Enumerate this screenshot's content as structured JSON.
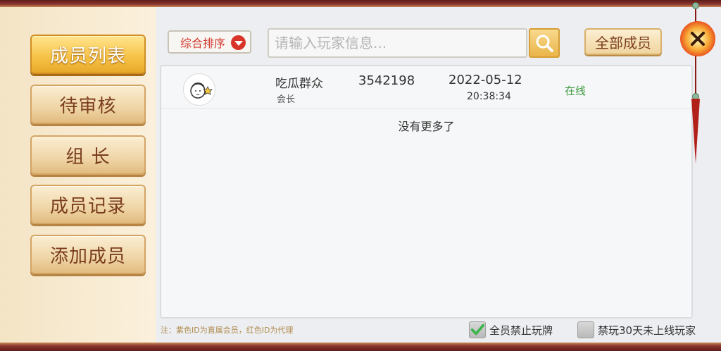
{
  "sidebar": {
    "items": [
      {
        "label": "成员列表",
        "active": true
      },
      {
        "label": "待审核",
        "active": false
      },
      {
        "label": "组 长",
        "active": false
      },
      {
        "label": "成员记录",
        "active": false
      },
      {
        "label": "添加成员",
        "active": false
      }
    ]
  },
  "toolbar": {
    "sort_label": "综合排序",
    "search_placeholder": "请输入玩家信息...",
    "search_value": "",
    "all_members_label": "全部成员"
  },
  "members": [
    {
      "name": "吃瓜群众",
      "role": "会长",
      "id": "3542198",
      "date": "2022-05-12",
      "time": "20:38:34",
      "status": "在线"
    }
  ],
  "list_end_text": "没有更多了",
  "footer": {
    "note": "注：紫色ID为直属会员，红色ID为代理",
    "checkbox_ban_all": {
      "label": "全员禁止玩牌",
      "checked": true
    },
    "checkbox_ban_inactive": {
      "label": "禁玩30天未上线玩家",
      "checked": false
    }
  },
  "colors": {
    "accent_gold": "#f7c44a",
    "status_online": "#3f9b3f",
    "sort_red": "#d23a2e",
    "frame_red": "#7a2a26"
  },
  "icons": {
    "search": "search-icon",
    "close": "close-icon",
    "dropdown": "chevron-down-icon",
    "checkmark": "check-icon"
  }
}
